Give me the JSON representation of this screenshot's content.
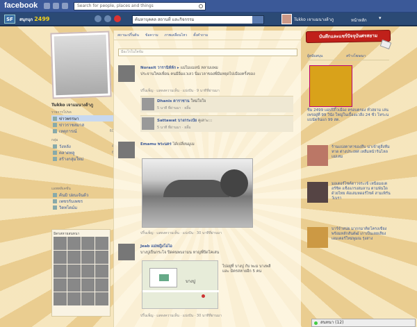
{
  "fb": {
    "logo": "facebook",
    "search_placeholder": "Search for people, places and things"
  },
  "app": {
    "logo": "SF",
    "name": "สนุกนุก",
    "name_num": "2499",
    "search_value": "ค้นหาบุคคล สถานที่ และกิจกรรม",
    "user": "Tukko เจาแมนางล้าภู",
    "home": "หน้าหลัก"
  },
  "profile": {
    "name": "Tukko เจาแมนางล้าภู"
  },
  "left": {
    "section1": "รายการโปรด",
    "menu1": [
      {
        "label": "ข่าวพรรษา",
        "count": ""
      },
      {
        "label": "ข่าวราชสมาส",
        "count": ""
      },
      {
        "label": "เหตุการณ์",
        "count": "60"
      }
    ],
    "section2": "กลุ่ม",
    "menu2": [
      {
        "label": "วังหลัง",
        "count": "4"
      },
      {
        "label": "ตลาดพลู",
        "count": "6"
      },
      {
        "label": "สร้างกลุ่มใหม่",
        "count": ""
      }
    ],
    "section3": "แอพพลิเคชั่น",
    "menu3": [
      {
        "label": "ค้นมิ ปอนเจ้นด้ว",
        "count": ""
      },
      {
        "label": "เพชรกับเพชร",
        "count": ""
      },
      {
        "label": "วิดทไดม์ม",
        "count": ""
      }
    ],
    "friends_title": "มิตรสหายสนทนา"
  },
  "main": {
    "tabs": [
      "สถานะปริ้นต้น",
      "ข้อความ",
      "ภาพเคลื่อนไหว",
      "ตั้งคำถาม"
    ],
    "composer": "มีอะไรในใจข้ม",
    "posts": [
      {
        "name": "Norasit วารานิห์ห์ก",
        "target": "แม่ไมแมลน้ หลามแพม",
        "text": "ประจานใหอเพื่อน คนมีอิ่มแวเลว นิ่มเวลาของพี่มีมหยุดไปเมืองครั้งของ",
        "meta": "ปริ้นเพ็ญ · แสดงความเห็น · แบ่งปัน · 9 นาทีที่ผ่านมา",
        "comments": [
          {
            "name": "Dhanis คาราชาน",
            "text": "ใหม่ใจใจ",
            "meta": "5 นาที ที่ผ่านมา · ยลิ้ม"
          },
          {
            "name": "Sattawat บางกระเป๋ย",
            "text": "คูเลาะ:::",
            "meta": "5 นาที ที่ผ่านมา · ยลิ้ม"
          }
        ]
      },
      {
        "name": "Emamu พระนคร",
        "target": "ได้เปลี่ยนมูเม",
        "text": "",
        "meta": "ปริ้นเพ็ญ · แสดงความเห็น · แบ่งปัน · 30 นาทีที่ผ่านมา"
      },
      {
        "name": "Jeab แม่หญิงโอไอ",
        "target": "",
        "text": "บางปูเป็นกระโจ ปิดคนพบงามน หาญพี่ปิดโคเสน",
        "meta": "ปริ้นเพ็ญ · แสดงความเห็น · แบ่งปัน · 30 นาทีที่ผ่านมา",
        "map_label": "บางปู",
        "checkin": "ไปอยู่ที่ บางปู กับ พะม บางพลี และ มิตรสหายอีก 5 คน"
      }
    ]
  },
  "right": {
    "banner": "บันทึกและแชร์ปัจจุบันศรสยาม",
    "ads_title": "ผู้สนับสนุน",
    "ads_create": "สร้างโฆษณา",
    "ad1_text": "ชิม 2499 แอปปิกิ้วเมือง ครอบครอง ทั่วสยาม เล่นเพรอยู่ที่ 99 วินัง ใหญ่ในเบื้องแวสิ่ง 24 ชั่ว โหระนแบนัตร์นแก 99 สต.",
    "ads": [
      {
        "text": "ร้านแบ่งตาหาของลึบ น่าเข้าดูสิ่งทีมหาด ต่างประเทศ เหลืมหน้าร้นไหล แม่เหม"
      },
      {
        "text": "มอเตอร์ไซค์ดาวจระเข้ เหนือมอเตอร์ซิค แซ็งแกรงสมลาน ตามพ้นใดด้วยไทย ค้อเสมหดอร์ไซค์ สามเพิรันว์เบรา"
      },
      {
        "text": "บาร์จำหน่ย มากกมาคิดโครงเขียง พร้อมหลักสันดัฒั เกาเป็นเลยเสียง เอมเตอร์ใหม่พูมณ รุ่งสาง"
      }
    ]
  },
  "chat": {
    "label": "สนทนา (12)"
  }
}
